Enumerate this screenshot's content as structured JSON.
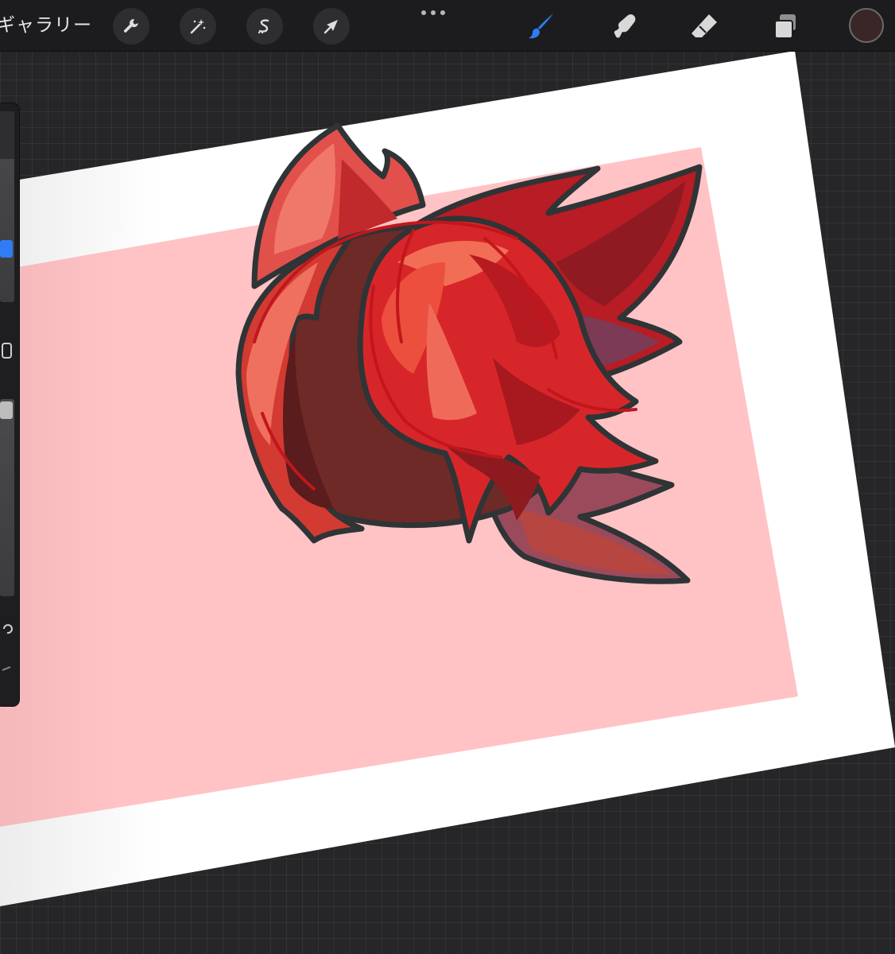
{
  "toolbar": {
    "gallery_label": "ギャラリー",
    "actions_icon": "wrench-icon",
    "adjustments_icon": "magic-wand-icon",
    "selection_icon": "selection-s-icon",
    "transform_icon": "arrow-cursor-icon",
    "more_icon": "more-dots-icon",
    "brush_icon": "brush-icon",
    "smudge_icon": "smudge-icon",
    "eraser_icon": "eraser-icon",
    "layers_icon": "layers-icon",
    "current_color": "#3a2527",
    "active_tool_color": "#2f7cf6"
  },
  "sidebar": {
    "brush_size_icon": "slider-icon",
    "modify_icon": "square-outline-icon",
    "opacity_icon": "slider-icon",
    "undo_icon": "undo-icon",
    "redo_icon": "redo-icon"
  },
  "canvas": {
    "paper_color": "#ffffff",
    "background_color": "#ffc3c5",
    "artwork": "red-hair-drawing"
  }
}
